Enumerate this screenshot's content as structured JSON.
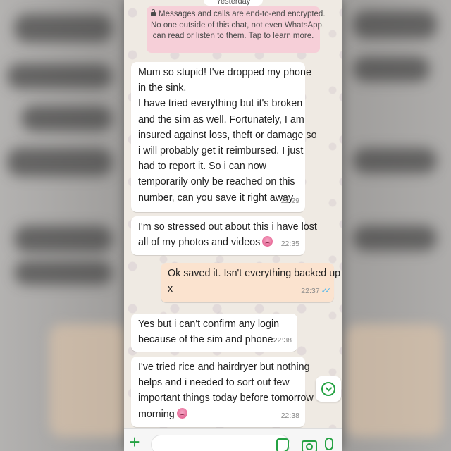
{
  "date_chip": "Yesterday",
  "encryption_notice": [
    "Messages and calls are end-to-end encrypted.",
    "No one outside of this chat, not even WhatsApp,",
    "can read or listen to them. Tap to learn more."
  ],
  "messages": [
    {
      "direction": "incoming",
      "lines": [
        "Mum so stupid! I've dropped my phone",
        "in the sink.",
        "I have tried everything but it's broken",
        "and the sim as well. Fortunately, I am",
        "insured against loss, theft or damage so",
        "i will probably get it reimbursed. I just",
        "had to report it. So i can now",
        "temporarily only be reached on this",
        "number, can you save it right away"
      ],
      "time": "22:29"
    },
    {
      "direction": "incoming",
      "lines": [
        "I'm so stressed out about this i have lost",
        "all of my photos and videos"
      ],
      "emoji": "sad-face-emoji",
      "time": "22:35"
    },
    {
      "direction": "outgoing",
      "lines": [
        "Ok saved it. Isn't everything backed up",
        "x"
      ],
      "time": "22:37",
      "read_ticks": "✓✓"
    },
    {
      "direction": "incoming",
      "lines": [
        "Yes but i can't confirm any login",
        "because of the sim and phone."
      ],
      "time": "22:38"
    },
    {
      "direction": "incoming",
      "lines": [
        "I've tried rice and hairdryer but nothing",
        "helps and i needed to sort out few",
        "important things today before tomorrow",
        "morning"
      ],
      "emoji": "sad-face-emoji",
      "time": "22:38"
    }
  ],
  "colors": {
    "incoming_bubble": "#ffffff",
    "outgoing_bubble": "#fbe3cf",
    "encryption_notice": "#f6cfd8",
    "accent_green": "#25a243",
    "read_ticks": "#4fb6ec"
  },
  "icons": [
    "lock-icon",
    "scroll-down-icon",
    "plus-icon",
    "sticker-icon",
    "camera-icon",
    "mic-icon"
  ]
}
